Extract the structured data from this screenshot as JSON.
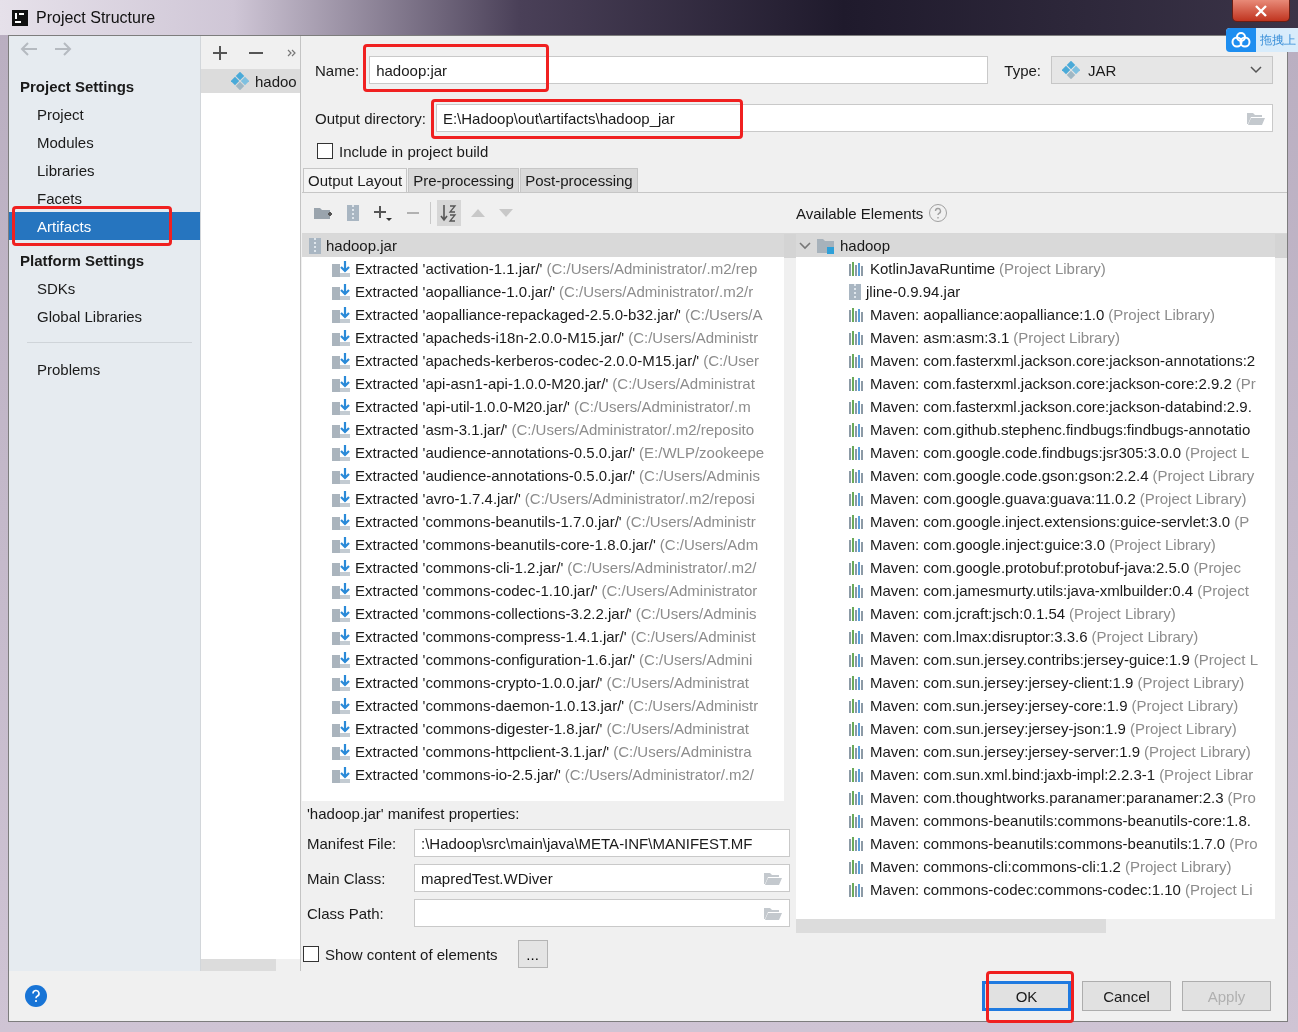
{
  "window": {
    "title": "Project Structure"
  },
  "upload_badge": {
    "label": "拖拽上"
  },
  "nav_buttons": [
    {
      "kind": "back",
      "disabled": true
    },
    {
      "kind": "forward",
      "disabled": true
    }
  ],
  "sidebar": {
    "sections": [
      {
        "heading": "Project Settings",
        "items": [
          {
            "label": "Project",
            "selected": false
          },
          {
            "label": "Modules",
            "selected": false
          },
          {
            "label": "Libraries",
            "selected": false
          },
          {
            "label": "Facets",
            "selected": false
          },
          {
            "label": "Artifacts",
            "selected": true,
            "highlighted": true
          }
        ]
      },
      {
        "heading": "Platform Settings",
        "items": [
          {
            "label": "SDKs",
            "selected": false
          },
          {
            "label": "Global Libraries",
            "selected": false
          }
        ]
      }
    ],
    "extra_items": [
      {
        "label": "Problems",
        "selected": false
      }
    ]
  },
  "artifact_list": {
    "items": [
      {
        "label": "hadoo",
        "selected": true
      }
    ]
  },
  "form": {
    "name": {
      "label": "Name:",
      "value": "hadoop:jar",
      "highlighted": true
    },
    "type": {
      "label": "Type:",
      "value": "JAR"
    },
    "output_directory": {
      "label": "Output directory:",
      "value": "E:\\Hadoop\\out\\artifacts\\hadoop_jar",
      "highlighted": true
    },
    "include_in_build": {
      "label": "Include in project build",
      "checked": false
    }
  },
  "tabs": [
    {
      "label": "Output Layout",
      "selected": true
    },
    {
      "label": "Pre-processing",
      "selected": false
    },
    {
      "label": "Post-processing",
      "selected": false
    }
  ],
  "layout_toolbar": [
    {
      "kind": "new-folder",
      "disabled": false,
      "pressed": false
    },
    {
      "kind": "archive",
      "disabled": false,
      "pressed": false
    },
    {
      "kind": "add",
      "disabled": false,
      "pressed": false
    },
    {
      "kind": "remove",
      "disabled": true,
      "pressed": false
    },
    {
      "kind": "sort",
      "disabled": false,
      "pressed": true
    },
    {
      "kind": "up",
      "disabled": true,
      "pressed": false
    },
    {
      "kind": "down",
      "disabled": true,
      "pressed": false
    }
  ],
  "output_tree": {
    "root": {
      "label": "hadoop.jar",
      "selected": true
    },
    "items": [
      {
        "name": "Extracted 'activation-1.1.jar/'",
        "path": "(C:/Users/Administrator/.m2/rep"
      },
      {
        "name": "Extracted 'aopalliance-1.0.jar/'",
        "path": "(C:/Users/Administrator/.m2/r"
      },
      {
        "name": "Extracted 'aopalliance-repackaged-2.5.0-b32.jar/'",
        "path": "(C:/Users/A"
      },
      {
        "name": "Extracted 'apacheds-i18n-2.0.0-M15.jar/'",
        "path": "(C:/Users/Administr"
      },
      {
        "name": "Extracted 'apacheds-kerberos-codec-2.0.0-M15.jar/'",
        "path": "(C:/User"
      },
      {
        "name": "Extracted 'api-asn1-api-1.0.0-M20.jar/'",
        "path": "(C:/Users/Administrat"
      },
      {
        "name": "Extracted 'api-util-1.0.0-M20.jar/'",
        "path": "(C:/Users/Administrator/.m"
      },
      {
        "name": "Extracted 'asm-3.1.jar/'",
        "path": "(C:/Users/Administrator/.m2/reposito"
      },
      {
        "name": "Extracted 'audience-annotations-0.5.0.jar/'",
        "path": "(E:/WLP/zookeepe"
      },
      {
        "name": "Extracted 'audience-annotations-0.5.0.jar/'",
        "path": "(C:/Users/Adminis"
      },
      {
        "name": "Extracted 'avro-1.7.4.jar/'",
        "path": "(C:/Users/Administrator/.m2/reposi"
      },
      {
        "name": "Extracted 'commons-beanutils-1.7.0.jar/'",
        "path": "(C:/Users/Administr"
      },
      {
        "name": "Extracted 'commons-beanutils-core-1.8.0.jar/'",
        "path": "(C:/Users/Adm"
      },
      {
        "name": "Extracted 'commons-cli-1.2.jar/'",
        "path": "(C:/Users/Administrator/.m2/"
      },
      {
        "name": "Extracted 'commons-codec-1.10.jar/'",
        "path": "(C:/Users/Administrator"
      },
      {
        "name": "Extracted 'commons-collections-3.2.2.jar/'",
        "path": "(C:/Users/Adminis"
      },
      {
        "name": "Extracted 'commons-compress-1.4.1.jar/'",
        "path": "(C:/Users/Administ"
      },
      {
        "name": "Extracted 'commons-configuration-1.6.jar/'",
        "path": "(C:/Users/Admini"
      },
      {
        "name": "Extracted 'commons-crypto-1.0.0.jar/'",
        "path": "(C:/Users/Administrat"
      },
      {
        "name": "Extracted 'commons-daemon-1.0.13.jar/'",
        "path": "(C:/Users/Administr"
      },
      {
        "name": "Extracted 'commons-digester-1.8.jar/'",
        "path": "(C:/Users/Administrat"
      },
      {
        "name": "Extracted 'commons-httpclient-3.1.jar/'",
        "path": "(C:/Users/Administra"
      },
      {
        "name": "Extracted 'commons-io-2.5.jar/'",
        "path": "(C:/Users/Administrator/.m2/"
      }
    ]
  },
  "manifest": {
    "title": "'hadoop.jar' manifest properties:",
    "fields": [
      {
        "label": "Manifest File:",
        "value": ":\\Hadoop\\src\\main\\java\\META-INF\\MANIFEST.MF",
        "browse": false
      },
      {
        "label": "Main Class:",
        "value": "mapredTest.WDiver",
        "browse": true
      },
      {
        "label": "Class Path:",
        "browse": true
      }
    ]
  },
  "show_content": {
    "label": "Show content of elements",
    "checked": false,
    "button": "..."
  },
  "available": {
    "title": "Available Elements",
    "root": {
      "label": "hadoop",
      "expanded": true,
      "selected": true
    },
    "items": [
      {
        "kind": "library",
        "name": "KotlinJavaRuntime",
        "note": "(Project Library)"
      },
      {
        "kind": "jar",
        "name": "jline-0.9.94.jar"
      },
      {
        "kind": "library",
        "name": "Maven: aopalliance:aopalliance:1.0",
        "note": "(Project Library)"
      },
      {
        "kind": "library",
        "name": "Maven: asm:asm:3.1",
        "note": "(Project Library)"
      },
      {
        "kind": "library",
        "name": "Maven: com.fasterxml.jackson.core:jackson-annotations:2"
      },
      {
        "kind": "library",
        "name": "Maven: com.fasterxml.jackson.core:jackson-core:2.9.2",
        "note": "(Pr"
      },
      {
        "kind": "library",
        "name": "Maven: com.fasterxml.jackson.core:jackson-databind:2.9."
      },
      {
        "kind": "library",
        "name": "Maven: com.github.stephenc.findbugs:findbugs-annotatio"
      },
      {
        "kind": "library",
        "name": "Maven: com.google.code.findbugs:jsr305:3.0.0",
        "note": "(Project L"
      },
      {
        "kind": "library",
        "name": "Maven: com.google.code.gson:gson:2.2.4",
        "note": "(Project Library"
      },
      {
        "kind": "library",
        "name": "Maven: com.google.guava:guava:11.0.2",
        "note": "(Project Library)"
      },
      {
        "kind": "library",
        "name": "Maven: com.google.inject.extensions:guice-servlet:3.0",
        "note": "(P"
      },
      {
        "kind": "library",
        "name": "Maven: com.google.inject:guice:3.0",
        "note": "(Project Library)"
      },
      {
        "kind": "library",
        "name": "Maven: com.google.protobuf:protobuf-java:2.5.0",
        "note": "(Projec"
      },
      {
        "kind": "library",
        "name": "Maven: com.jamesmurty.utils:java-xmlbuilder:0.4",
        "note": "(Project"
      },
      {
        "kind": "library",
        "name": "Maven: com.jcraft:jsch:0.1.54",
        "note": "(Project Library)"
      },
      {
        "kind": "library",
        "name": "Maven: com.lmax:disruptor:3.3.6",
        "note": "(Project Library)"
      },
      {
        "kind": "library",
        "name": "Maven: com.sun.jersey.contribs:jersey-guice:1.9",
        "note": "(Project L"
      },
      {
        "kind": "library",
        "name": "Maven: com.sun.jersey:jersey-client:1.9",
        "note": "(Project Library)"
      },
      {
        "kind": "library",
        "name": "Maven: com.sun.jersey:jersey-core:1.9",
        "note": "(Project Library)"
      },
      {
        "kind": "library",
        "name": "Maven: com.sun.jersey:jersey-json:1.9",
        "note": "(Project Library)"
      },
      {
        "kind": "library",
        "name": "Maven: com.sun.jersey:jersey-server:1.9",
        "note": "(Project Library)"
      },
      {
        "kind": "library",
        "name": "Maven: com.sun.xml.bind:jaxb-impl:2.2.3-1",
        "note": "(Project Librar"
      },
      {
        "kind": "library",
        "name": "Maven: com.thoughtworks.paranamer:paranamer:2.3",
        "note": "(Pro"
      },
      {
        "kind": "library",
        "name": "Maven: commons-beanutils:commons-beanutils-core:1.8."
      },
      {
        "kind": "library",
        "name": "Maven: commons-beanutils:commons-beanutils:1.7.0",
        "note": "(Pro"
      },
      {
        "kind": "library",
        "name": "Maven: commons-cli:commons-cli:1.2",
        "note": "(Project Library)"
      },
      {
        "kind": "library",
        "name": "Maven: commons-codec:commons-codec:1.10",
        "note": "(Project Li"
      }
    ]
  },
  "buttons": [
    {
      "label": "OK",
      "default": true,
      "disabled": false,
      "highlighted": true
    },
    {
      "label": "Cancel",
      "default": false,
      "disabled": false,
      "highlighted": false
    },
    {
      "label": "Apply",
      "default": false,
      "disabled": true,
      "highlighted": false
    }
  ]
}
